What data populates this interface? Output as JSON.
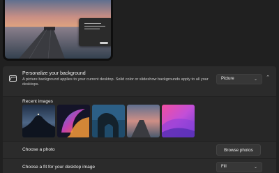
{
  "preview": {
    "colors": {
      "sky_top": "#6f7e9a",
      "sky_mid": "#c98f85",
      "horizon": "#e2a57e",
      "water": "#4f5f73",
      "pier": "#3a3a3a"
    }
  },
  "background": {
    "icon": "image-icon",
    "title": "Personalize your background",
    "description": "A picture background applies to your current desktop. Solid color or slideshow backgrounds apply to all your desktops.",
    "dropdown_value": "Picture",
    "collapse_icon": "chevron-up-icon"
  },
  "recent": {
    "label": "Recent images",
    "images": [
      "night-rock",
      "glow-swirl",
      "sea-arch",
      "sunset-pier",
      "pink-waves"
    ]
  },
  "photo": {
    "label": "Choose a photo",
    "button": "Browse photos"
  },
  "fit": {
    "label": "Choose a fit for your desktop image",
    "dropdown_value": "Fill"
  },
  "chevron_down": "⌄",
  "chevron_up": "⌃"
}
